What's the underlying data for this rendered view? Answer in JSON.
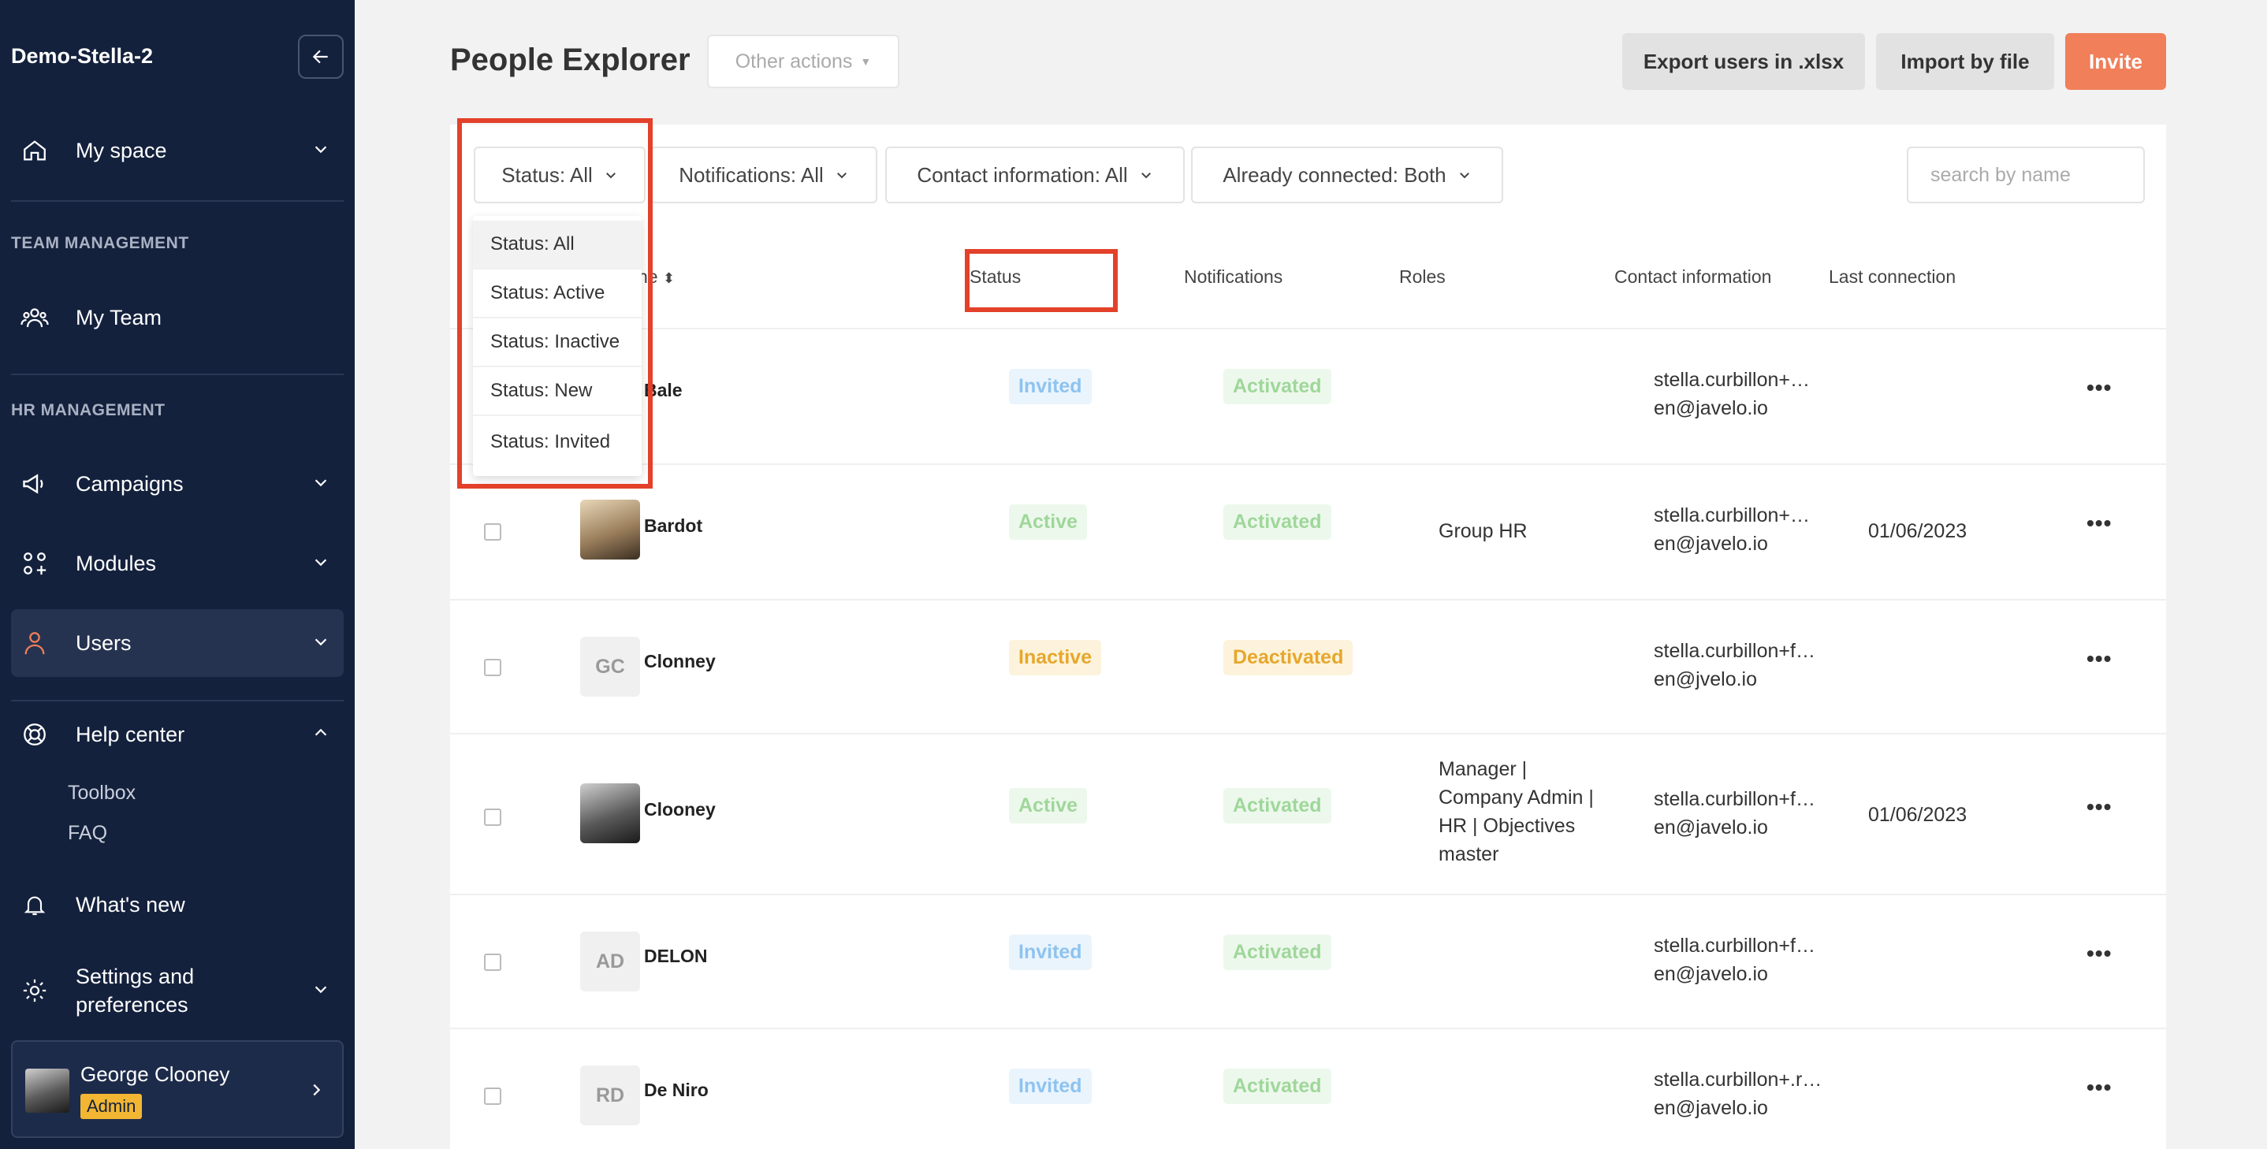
{
  "sidebar": {
    "brand": "Demo-Stella-2",
    "nav": {
      "my_space": "My space",
      "team_section": "TEAM MANAGEMENT",
      "my_team": "My Team",
      "hr_section": "HR MANAGEMENT",
      "campaigns": "Campaigns",
      "modules": "Modules",
      "users": "Users",
      "help_center": "Help center",
      "toolbox": "Toolbox",
      "faq": "FAQ",
      "whats_new": "What's new",
      "settings_line1": "Settings and",
      "settings_line2": "preferences"
    },
    "user": {
      "name": "George Clooney",
      "role": "Admin"
    }
  },
  "header": {
    "title": "People Explorer",
    "other_actions": "Other actions",
    "export": "Export users in .xlsx",
    "import": "Import by file",
    "invite": "Invite"
  },
  "filters": {
    "status": "Status: All",
    "notifications": "Notifications: All",
    "contact": "Contact information: All",
    "connected": "Already connected: Both",
    "search_placeholder": "search by name"
  },
  "dropdown": {
    "options": [
      "Status: All",
      "Status: Active",
      "Status: Inactive",
      "Status: New",
      "Status: Invited"
    ],
    "selected": "Status: All"
  },
  "table": {
    "columns": {
      "name_partial": "ne",
      "status": "Status",
      "notifications": "Notifications",
      "roles": "Roles",
      "contact": "Contact information",
      "last": "Last connection"
    },
    "rows": [
      {
        "initials": "",
        "name": "Bale",
        "status": "Invited",
        "notif": "Activated",
        "roles": "",
        "contact1": "stella.curbillon+…",
        "contact2": "en@javelo.io",
        "last": ""
      },
      {
        "initials": "",
        "name": "Bardot",
        "status": "Active",
        "notif": "Activated",
        "roles": "Group HR",
        "contact1": "stella.curbillon+…",
        "contact2": "en@javelo.io",
        "last": "01/06/2023"
      },
      {
        "initials": "GC",
        "name": "Clonney",
        "status": "Inactive",
        "notif": "Deactivated",
        "roles": "",
        "contact1": "stella.curbillon+f…",
        "contact2": "en@jvelo.io",
        "last": ""
      },
      {
        "initials": "",
        "name": "Clooney",
        "status": "Active",
        "notif": "Activated",
        "roles1": "Manager |",
        "roles2": "Company Admin |",
        "roles3": "HR | Objectives",
        "roles4": "master",
        "contact1": "stella.curbillon+f…",
        "contact2": "en@javelo.io",
        "last": "01/06/2023"
      },
      {
        "initials": "AD",
        "name": "DELON",
        "status": "Invited",
        "notif": "Activated",
        "roles": "",
        "contact1": "stella.curbillon+f…",
        "contact2": "en@javelo.io",
        "last": ""
      },
      {
        "initials": "RD",
        "name": "De Niro",
        "status": "Invited",
        "notif": "Activated",
        "roles": "",
        "contact1": "stella.curbillon+.r…",
        "contact2": "en@javelo.io",
        "last": ""
      }
    ],
    "more": "•••"
  },
  "colors": {
    "sidebar": "#14213d",
    "accent": "#f07f5a",
    "highlight": "#e3412a"
  }
}
